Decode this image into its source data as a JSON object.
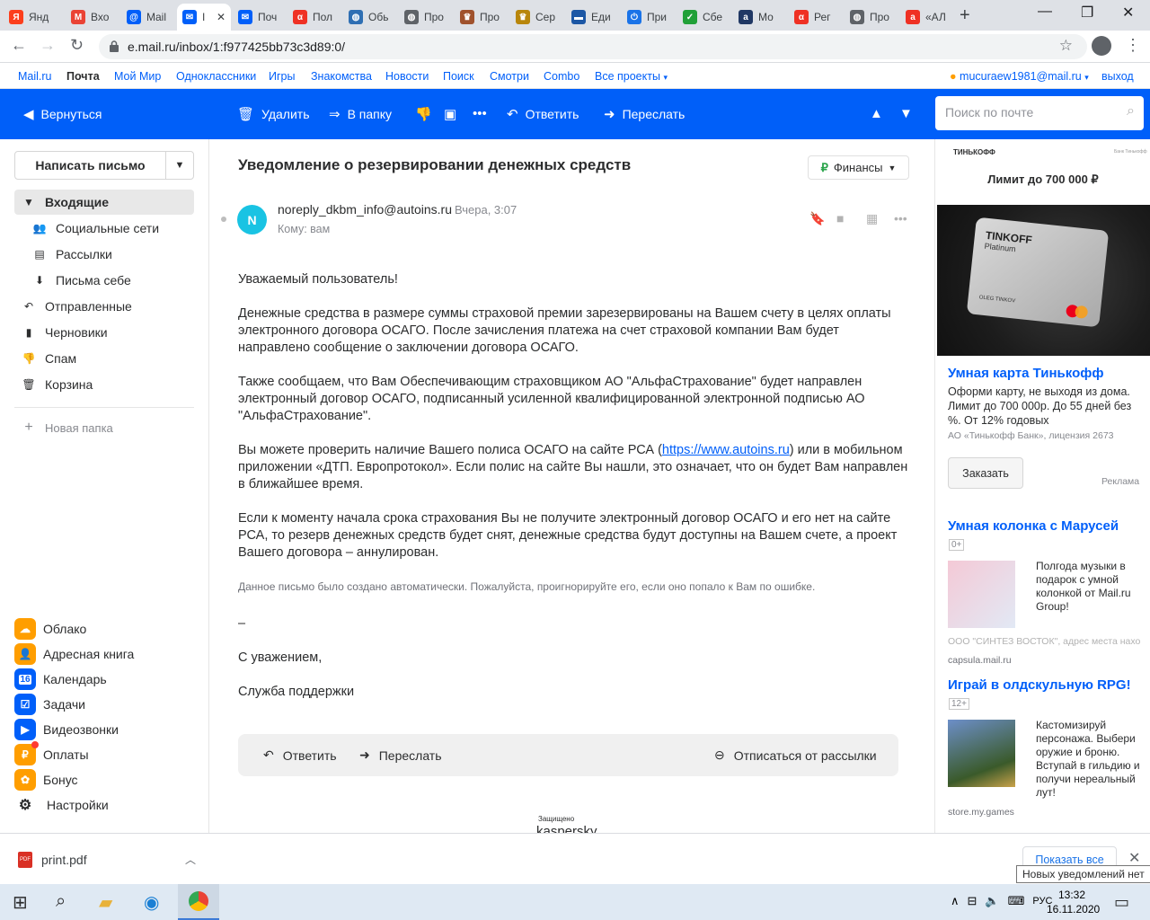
{
  "browser": {
    "tabs": [
      {
        "label": "Янд",
        "icon": "yandex-icon",
        "color": "#fc3f1d"
      },
      {
        "label": "Вхо",
        "icon": "gmail-icon",
        "color": "#ea4335"
      },
      {
        "label": "Mail",
        "icon": "mailru-icon",
        "color": "#005ff9"
      },
      {
        "label": "I",
        "icon": "mail-envelope-icon",
        "color": "#005ff9"
      },
      {
        "label": "Поч",
        "icon": "mail-envelope-icon",
        "color": "#005ff9"
      },
      {
        "label": "Пол",
        "icon": "alfa-icon",
        "color": "#ef3124"
      },
      {
        "label": "Обь",
        "icon": "globe-icon",
        "color": "#2f6fb3"
      },
      {
        "label": "Про",
        "icon": "globe-icon",
        "color": "#5f6368"
      },
      {
        "label": "Про",
        "icon": "emblem-icon",
        "color": "#a0522d"
      },
      {
        "label": "Сер",
        "icon": "emblem-icon",
        "color": "#b8860b"
      },
      {
        "label": "Еди",
        "icon": "flag-icon",
        "color": "#1c57a5"
      },
      {
        "label": "При",
        "icon": "power-icon",
        "color": "#1a73e8"
      },
      {
        "label": "Сбе",
        "icon": "sber-icon",
        "color": "#21a038"
      },
      {
        "label": "Мо",
        "icon": "a-icon",
        "color": "#203864"
      },
      {
        "label": "Рег",
        "icon": "alfa-icon",
        "color": "#ef3124"
      },
      {
        "label": "Про",
        "icon": "globe-icon",
        "color": "#5f6368"
      },
      {
        "label": "«АЛ",
        "icon": "a-icon",
        "color": "#ef3124"
      }
    ],
    "url": "e.mail.ru/inbox/1:f977425bb73c3d89:0/"
  },
  "portal": {
    "items": [
      "Mail.ru",
      "Почта",
      "Мой Мир",
      "Одноклассники",
      "Игры",
      "Знакомства",
      "Новости",
      "Поиск",
      "Смотри",
      "Combo",
      "Все проекты"
    ],
    "user": "mucuraew1981@mail.ru",
    "logout": "выход"
  },
  "toolbar": {
    "back": "Вернуться",
    "delete": "Удалить",
    "to_folder": "В папку",
    "reply": "Ответить",
    "forward": "Переслать",
    "search_placeholder": "Поиск по почте"
  },
  "sidebar": {
    "compose": "Написать письмо",
    "folders": [
      {
        "label": "Входящие",
        "icon": "caret-down-icon"
      },
      {
        "label": "Социальные сети",
        "icon": "people-icon"
      },
      {
        "label": "Рассылки",
        "icon": "newsletter-icon"
      },
      {
        "label": "Письма себе",
        "icon": "self-mail-icon"
      },
      {
        "label": "Отправленные",
        "icon": "reply-icon"
      },
      {
        "label": "Черновики",
        "icon": "draft-icon"
      },
      {
        "label": "Спам",
        "icon": "thumb-down-icon"
      },
      {
        "label": "Корзина",
        "icon": "trash-icon"
      }
    ],
    "new_folder": "Новая папка",
    "services": [
      {
        "label": "Облако",
        "icon": "cloud-icon",
        "color": "#ff9e00"
      },
      {
        "label": "Адресная книга",
        "icon": "contacts-icon",
        "color": "#ff9e00"
      },
      {
        "label": "Календарь",
        "icon": "calendar-icon",
        "color": "#005ff9",
        "badge": "16"
      },
      {
        "label": "Задачи",
        "icon": "tasks-icon",
        "color": "#005ff9"
      },
      {
        "label": "Видеозвонки",
        "icon": "video-icon",
        "color": "#005ff9"
      },
      {
        "label": "Оплаты",
        "icon": "payments-icon",
        "color": "#ff9e00"
      },
      {
        "label": "Бонус",
        "icon": "bonus-icon",
        "color": "#ff9e00"
      },
      {
        "label": "Настройки",
        "icon": "gear-icon",
        "color": "#ffffff"
      }
    ]
  },
  "message": {
    "subject": "Уведомление о резервировании денежных средств",
    "category": "Финансы",
    "avatar_letter": "N",
    "from": "noreply_dkbm_info@autoins.ru",
    "date": "Вчера, 3:07",
    "to": "Кому: вам",
    "greeting": "Уважаемый пользователь!",
    "p1": "Денежные средства в размере суммы страховой премии зарезервированы на Вашем счету в целях оплаты электронного договора ОСАГО. После зачисления платежа на счет страховой компании Вам будет направлено сообщение о заключении договора ОСАГО.",
    "p2": "Также сообщаем, что Вам Обеспечивающим страховщиком АО \"АльфаСтрахование\" будет направлен электронный договор ОСАГО, подписанный усиленной квалифицированной электронной подписью АО \"АльфаСтрахование\".",
    "p3_before": "Вы можете проверить наличие Вашего полиса ОСАГО на сайте РСА (",
    "p3_link": "https://www.autoins.ru",
    "p3_after": ") или в мобильном приложении «ДТП. Европротокол». Если полис на сайте Вы нашли, это означает, что он будет Вам направлен в ближайшее время.",
    "p4": "Если к моменту начала срока страхования Вы не получите электронный договор ОСАГО и его нет на сайте РСА, то резерв денежных средств будет снят, денежные средства будут доступны на Вашем счете, а проект Вашего договора – аннулирован.",
    "auto_note": "Данное письмо было создано автоматически. Пожалуйста, проигнорируйте его, если оно попало к Вам по ошибке.",
    "dash": "–",
    "regards": "С уважением,",
    "signature": "Служба поддержки",
    "reply": "Ответить",
    "forward": "Переслать",
    "unsubscribe": "Отписаться от рассылки",
    "protected": "Защищено",
    "kaspersky": "kaspersky"
  },
  "ads": {
    "tinkoff_logo": "ТИНЬКОФФ",
    "tinkoff_logo_small": "Банк Тинькофф",
    "limit": "Лимит до 700 000 ₽",
    "card_brand": "TINKOFF",
    "card_tier": "Platinum",
    "card_holder": "OLEG TINKOV",
    "ad1_title": "Умная карта Тинькофф",
    "ad1_text": "Оформи карту, не выходя из дома. Лимит до 700 000р. До 55 дней без %. От 12% годовых",
    "ad1_legal": "АО «Тинькофф Банк», лицензия 2673",
    "order": "Заказать",
    "ad_label": "Реклама",
    "ad2_title": "Умная колонка с Марусей",
    "ad2_age": "0+",
    "ad2_text": "Полгода музыки в подарок с умной колонкой от Mail.ru Group!",
    "ad2_legal": "ООО \"СИНТЕЗ ВОСТОК\", адрес места нахо",
    "ad2_domain": "capsula.mail.ru",
    "ad3_title": "Играй в олдскульную RPG!",
    "ad3_age": "12+",
    "ad3_text": "Кастомизируй персонажа. Выбери оружие и броню. Вступай в гильдию и получи нереальный лут!",
    "ad3_domain": "store.my.games"
  },
  "downloads": {
    "file": "print.pdf",
    "show_all": "Показать все",
    "tooltip": "Новых уведомлений нет"
  },
  "taskbar": {
    "lang": "РУС",
    "time": "13:32",
    "date": "16.11.2020"
  }
}
